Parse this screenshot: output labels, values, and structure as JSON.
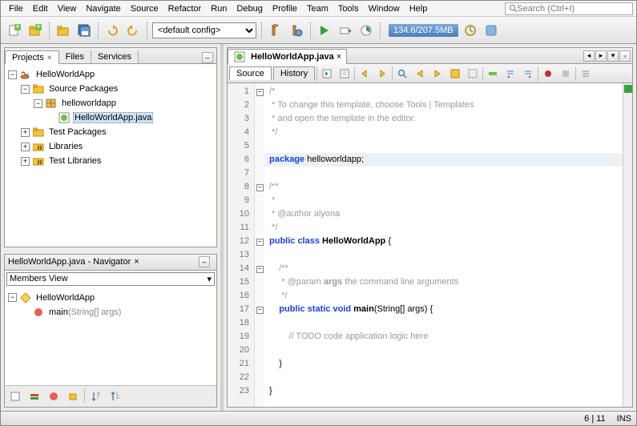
{
  "menu": [
    "File",
    "Edit",
    "View",
    "Navigate",
    "Source",
    "Refactor",
    "Run",
    "Debug",
    "Profile",
    "Team",
    "Tools",
    "Window",
    "Help"
  ],
  "search": {
    "placeholder": "Search (Ctrl+I)"
  },
  "toolbar": {
    "config": "<default config>",
    "memory": "134.6/207.5MB"
  },
  "projects": {
    "tabs": [
      "Projects",
      "Files",
      "Services"
    ],
    "tree": {
      "root": "HelloWorldApp",
      "nodes": [
        {
          "label": "Source Packages",
          "expanded": true,
          "indent": 1,
          "icon": "pkg-folder",
          "children": [
            {
              "label": "helloworldapp",
              "expanded": true,
              "indent": 2,
              "icon": "package",
              "children": [
                {
                  "label": "HelloWorldApp.java",
                  "indent": 3,
                  "icon": "java",
                  "selected": true
                }
              ]
            }
          ]
        },
        {
          "label": "Test Packages",
          "expanded": false,
          "indent": 1,
          "icon": "pkg-folder"
        },
        {
          "label": "Libraries",
          "expanded": false,
          "indent": 1,
          "icon": "lib-folder"
        },
        {
          "label": "Test Libraries",
          "expanded": false,
          "indent": 1,
          "icon": "lib-folder"
        }
      ]
    }
  },
  "navigator": {
    "title": "HelloWorldApp.java - Navigator",
    "view": "Members View",
    "items": [
      {
        "label": "HelloWorldApp",
        "icon": "class",
        "indent": 0,
        "expanded": true
      },
      {
        "label": "main",
        "sig": "(String[] args)",
        "icon": "method",
        "indent": 1
      }
    ]
  },
  "editor": {
    "tab": "HelloWorldApp.java",
    "subtabs": [
      "Source",
      "History"
    ],
    "lines": [
      {
        "n": 1,
        "fold": "-",
        "code": "/*",
        "cls": "cmt"
      },
      {
        "n": 2,
        "code": " * To change this template, choose Tools | Templates",
        "cls": "cmt"
      },
      {
        "n": 3,
        "code": " * and open the template in the editor.",
        "cls": "cmt"
      },
      {
        "n": 4,
        "code": " */",
        "cls": "cmt"
      },
      {
        "n": 5,
        "code": ""
      },
      {
        "n": 6,
        "hl": true,
        "seg": [
          {
            "t": "package ",
            "c": "kw"
          },
          {
            "t": "helloworldapp;",
            "c": "id"
          }
        ]
      },
      {
        "n": 7,
        "code": ""
      },
      {
        "n": 8,
        "fold": "-",
        "code": "/**",
        "cls": "cmt"
      },
      {
        "n": 9,
        "code": " *",
        "cls": "cmt"
      },
      {
        "n": 10,
        "code": " * @author alyona",
        "cls": "cmt"
      },
      {
        "n": 11,
        "code": " */",
        "cls": "cmt"
      },
      {
        "n": 12,
        "fold": "-",
        "seg": [
          {
            "t": "public class ",
            "c": "kw"
          },
          {
            "t": "HelloWorldApp ",
            "c": "id bold"
          },
          {
            "t": "{",
            "c": "id"
          }
        ]
      },
      {
        "n": 13,
        "code": ""
      },
      {
        "n": 14,
        "fold": "-",
        "code": "    /**",
        "cls": "cmt"
      },
      {
        "n": 15,
        "seg": [
          {
            "t": "     * @param ",
            "c": "cmt"
          },
          {
            "t": "args",
            "c": "cmt bold"
          },
          {
            "t": " the command line arguments",
            "c": "cmt"
          }
        ]
      },
      {
        "n": 16,
        "code": "     */",
        "cls": "cmt"
      },
      {
        "n": 17,
        "fold": "-",
        "seg": [
          {
            "t": "    ",
            "c": ""
          },
          {
            "t": "public static void ",
            "c": "kw"
          },
          {
            "t": "main",
            "c": "id bold italic"
          },
          {
            "t": "(String[] args) {",
            "c": "id"
          }
        ]
      },
      {
        "n": 18,
        "code": ""
      },
      {
        "n": 19,
        "code": "        // TODO code application logic here",
        "cls": "cmt"
      },
      {
        "n": 20,
        "code": ""
      },
      {
        "n": 21,
        "code": "    }"
      },
      {
        "n": 22,
        "code": ""
      },
      {
        "n": 23,
        "code": "}"
      }
    ]
  },
  "status": {
    "pos": "6 | 11",
    "ins": "INS"
  }
}
